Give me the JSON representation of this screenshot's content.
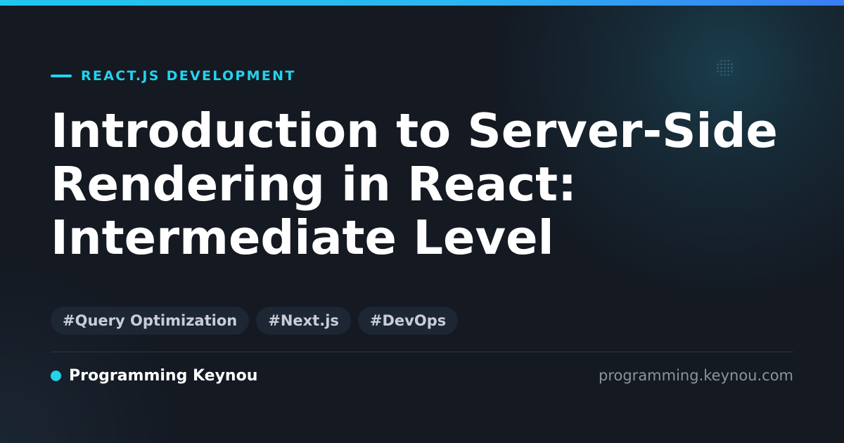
{
  "category": {
    "label": "REACT.JS DEVELOPMENT"
  },
  "title": {
    "line1": "Introduction to Server-Side",
    "line2": "Rendering in React:",
    "line3": "Intermediate Level"
  },
  "tags": [
    "#Query Optimization",
    "#Next.js",
    "#DevOps"
  ],
  "footer": {
    "brand": "Programming Keynou",
    "url": "programming.keynou.com"
  },
  "colors": {
    "accent": "#22d3ee",
    "background": "#141922",
    "tag_background": "#1d2633",
    "title_text": "#ffffff",
    "muted_text": "#8b949f"
  }
}
